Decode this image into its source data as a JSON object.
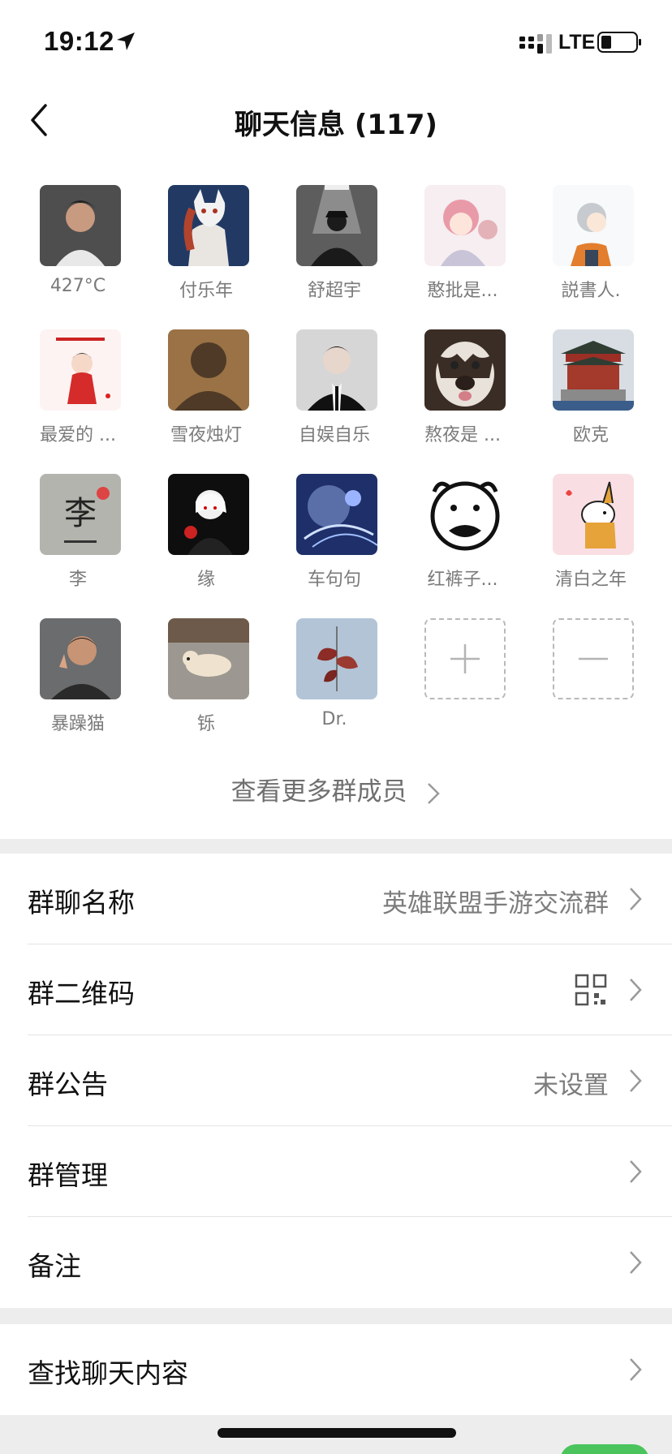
{
  "status_bar": {
    "time": "19:12",
    "network": "LTE"
  },
  "nav": {
    "title": "聊天信息 (117)",
    "back_icon": "chevron-left-icon"
  },
  "members": [
    {
      "name": "427°C",
      "avatar_color": "#5a5a5a"
    },
    {
      "name": "付乐年",
      "avatar_color": "#2b3f66"
    },
    {
      "name": "舒超宇",
      "avatar_color": "#6a6a6a"
    },
    {
      "name": "憨批是...",
      "avatar_color": "#f3d5dc"
    },
    {
      "name": "説書人.",
      "avatar_color": "#eaf0f5"
    },
    {
      "name": "最爱的 ...",
      "avatar_color": "#fbeaea"
    },
    {
      "name": "雪夜烛灯",
      "avatar_color": "#7d5a3a"
    },
    {
      "name": "自娱自乐",
      "avatar_color": "#3a3a3a"
    },
    {
      "name": "熬夜是 ...",
      "avatar_color": "#4a3a30"
    },
    {
      "name": "欧克",
      "avatar_color": "#8a3a30"
    },
    {
      "name": "李",
      "avatar_color": "#b7b7b2"
    },
    {
      "name": "缘",
      "avatar_color": "#111111"
    },
    {
      "name": "车句句",
      "avatar_color": "#2a3f8a"
    },
    {
      "name": "红裤子...",
      "avatar_color": "#ffffff"
    },
    {
      "name": "清白之年",
      "avatar_color": "#f8e1e4"
    },
    {
      "name": "暴躁猫",
      "avatar_color": "#55575a"
    },
    {
      "name": "铄",
      "avatar_color": "#9a968f"
    },
    {
      "name": "Dr.",
      "avatar_color": "#a9bccf"
    }
  ],
  "member_actions": {
    "add_icon": "plus-icon",
    "remove_icon": "minus-icon"
  },
  "more_members": "查看更多群成员",
  "settings": {
    "group_name": {
      "label": "群聊名称",
      "value": "英雄联盟手游交流群"
    },
    "qr_code": {
      "label": "群二维码",
      "icon": "qr-code-icon"
    },
    "announcement": {
      "label": "群公告",
      "value": "未设置"
    },
    "management": {
      "label": "群管理"
    },
    "remark": {
      "label": "备注"
    },
    "search_history": {
      "label": "查找聊天内容"
    }
  }
}
